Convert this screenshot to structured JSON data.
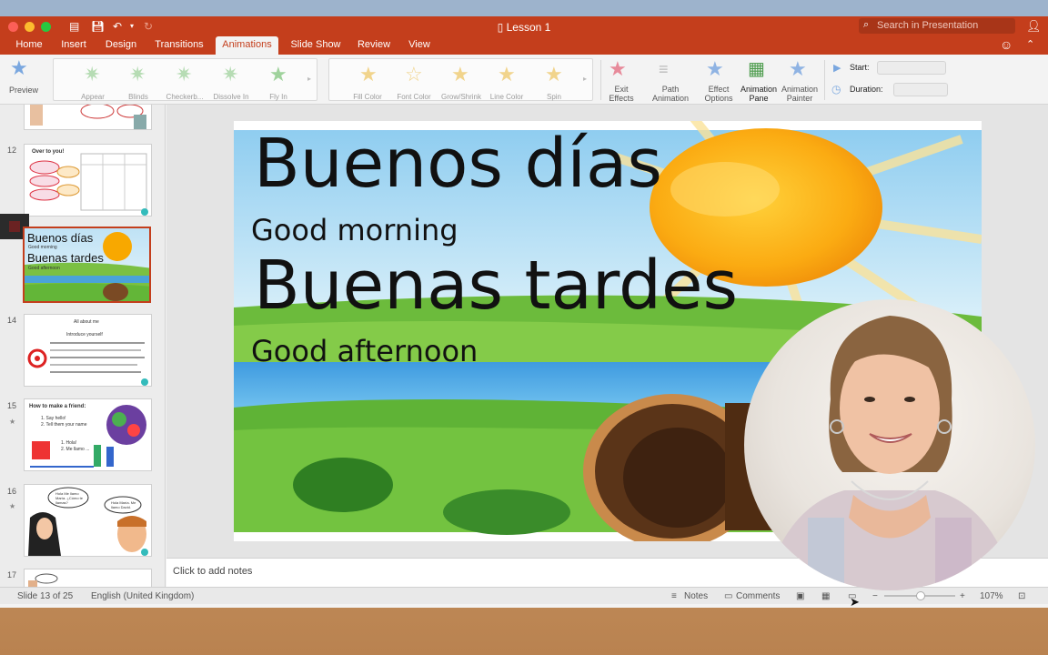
{
  "window": {
    "title": "Lesson 1"
  },
  "search": {
    "placeholder": "Search in Presentation"
  },
  "tabs": [
    "Home",
    "Insert",
    "Design",
    "Transitions",
    "Animations",
    "Slide Show",
    "Review",
    "View"
  ],
  "active_tab": "Animations",
  "ribbon": {
    "preview_label": "Preview",
    "entrance_effects": [
      "Appear",
      "Blinds",
      "Checkerb...",
      "Dissolve In",
      "Fly In"
    ],
    "emphasis_effects": [
      "Fill Color",
      "Font Color",
      "Grow/Shrink",
      "Line Color",
      "Spin"
    ],
    "exit_effects": "Exit Effects",
    "path_animation": "Path Animation",
    "effect_options": "Effect Options",
    "animation_pane": "Animation Pane",
    "animation_painter": "Animation Painter",
    "start_label": "Start:",
    "duration_label": "Duration:"
  },
  "thumbnails": {
    "numbers": [
      "12",
      "14",
      "15",
      "16",
      "17"
    ],
    "slide12_title": "Over to you!",
    "slide13_line1": "Buenos días",
    "slide13_line2": "Good morning",
    "slide13_line3": "Buenas tardes",
    "slide13_line4": "Good afternoon",
    "slide14_title": "All about me",
    "slide14_sub": "Introduce yourself",
    "slide15_title": "How to make a friend:",
    "slide15_items": [
      "1. Say hello!",
      "2. Tell them your name",
      "1. Hola!",
      "2. Me llamo ..."
    ],
    "slide16_bubble1": "Hola Me llamo María. ¿Cómo te llamas?",
    "slide16_bubble2": "Hola María. Me llamo David."
  },
  "slide": {
    "line1": "Buenos días",
    "line2": "Good morning",
    "line3": "Buenas tardes",
    "line4": "Good afternoon"
  },
  "notes_placeholder": "Click to add notes",
  "status": {
    "slide_counter": "Slide 13 of 25",
    "language": "English (United Kingdom)",
    "notes": "Notes",
    "comments": "Comments",
    "zoom": "107%"
  },
  "colors": {
    "accent": "#c43e1c",
    "selected_thumb": "#c43e1c"
  },
  "icons": [
    "undo-icon",
    "save-icon",
    "search-icon",
    "add-user-icon",
    "smiley-icon",
    "star-icon",
    "play-icon",
    "clock-icon",
    "notes-icon",
    "comments-icon",
    "normal-view-icon",
    "slide-sorter-icon",
    "slideshow-icon",
    "fit-window-icon"
  ]
}
